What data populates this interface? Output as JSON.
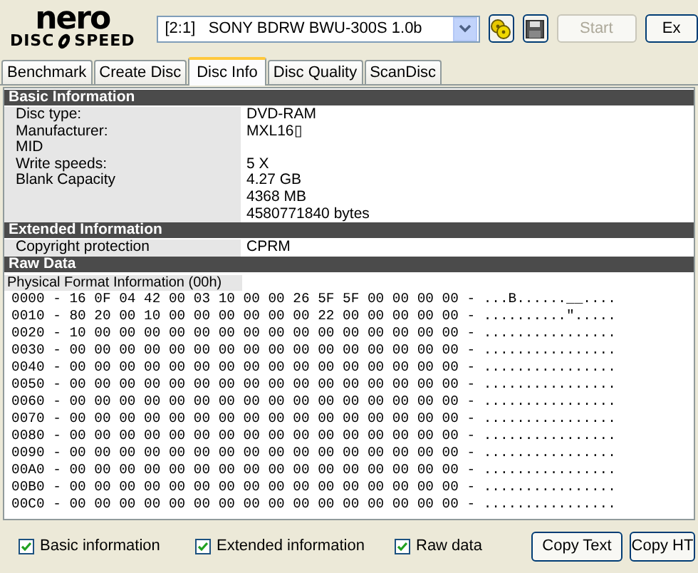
{
  "logo": {
    "top": "nero",
    "left": "DISC",
    "right": "SPEED"
  },
  "drive_select": {
    "value": "[2:1]   SONY BDRW BWU-300S 1.0b"
  },
  "toolbar_buttons": [
    {
      "label": "Start",
      "disabled": true
    },
    {
      "label": "Ex",
      "disabled": false
    }
  ],
  "tabs": [
    {
      "label": "Benchmark",
      "selected": false
    },
    {
      "label": "Create Disc",
      "selected": false
    },
    {
      "label": "Disc Info",
      "selected": true
    },
    {
      "label": "Disc Quality",
      "selected": false
    },
    {
      "label": "ScanDisc",
      "selected": false
    }
  ],
  "sections": [
    {
      "title": "Basic Information",
      "kind": "pairs",
      "rows": [
        {
          "label": "Disc type:",
          "values": [
            "DVD-RAM"
          ]
        },
        {
          "label": "Manufacturer:",
          "values": [
            "MXL16▯"
          ]
        },
        {
          "label": "MID",
          "values": []
        },
        {
          "label": "Write speeds:",
          "values": [
            "5 X"
          ]
        },
        {
          "label": "Blank Capacity",
          "values": [
            "4.27 GB",
            "4368 MB",
            "4580771840 bytes"
          ]
        }
      ]
    },
    {
      "title": "Extended Information",
      "kind": "pairs",
      "rows": [
        {
          "label": "Copyright protection",
          "values": [
            "CPRM"
          ]
        }
      ]
    },
    {
      "title": "Raw Data",
      "kind": "hex",
      "caption": "Physical Format Information (00h)",
      "rows": [
        "0000 - 16 0F 04 42 00 03 10 00 00 26 5F 5F 00 00 00 00 - ...B......__....",
        "0010 - 80 20 00 10 00 00 00 00 00 00 22 00 00 00 00 00 - ..........\".....",
        "0020 - 10 00 00 00 00 00 00 00 00 00 00 00 00 00 00 00 - ................",
        "0030 - 00 00 00 00 00 00 00 00 00 00 00 00 00 00 00 00 - ................",
        "0040 - 00 00 00 00 00 00 00 00 00 00 00 00 00 00 00 00 - ................",
        "0050 - 00 00 00 00 00 00 00 00 00 00 00 00 00 00 00 00 - ................",
        "0060 - 00 00 00 00 00 00 00 00 00 00 00 00 00 00 00 00 - ................",
        "0070 - 00 00 00 00 00 00 00 00 00 00 00 00 00 00 00 00 - ................",
        "0080 - 00 00 00 00 00 00 00 00 00 00 00 00 00 00 00 00 - ................",
        "0090 - 00 00 00 00 00 00 00 00 00 00 00 00 00 00 00 00 - ................",
        "00A0 - 00 00 00 00 00 00 00 00 00 00 00 00 00 00 00 00 - ................",
        "00B0 - 00 00 00 00 00 00 00 00 00 00 00 00 00 00 00 00 - ................",
        "00C0 - 00 00 00 00 00 00 00 00 00 00 00 00 00 00 00 00 - ................"
      ]
    }
  ],
  "options": [
    {
      "label": "Basic information",
      "checked": true
    },
    {
      "label": "Extended information",
      "checked": true
    },
    {
      "label": "Raw data",
      "checked": true
    }
  ],
  "footer_buttons": [
    "Copy Text",
    "Copy HT"
  ]
}
